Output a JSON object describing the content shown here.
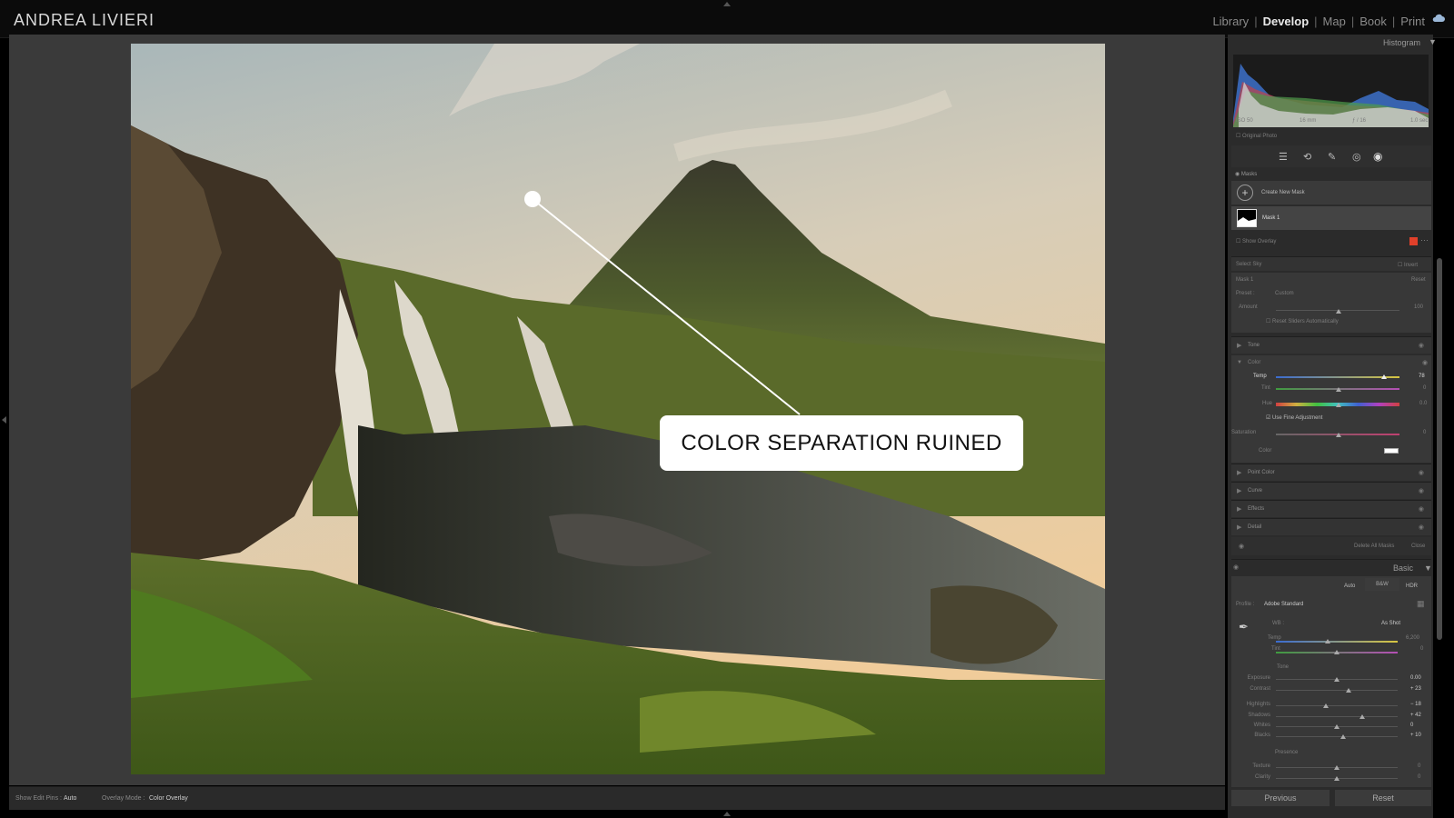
{
  "app": {
    "brand": "ANDREA LIVIERI"
  },
  "modules": [
    {
      "label": "Library",
      "active": false
    },
    {
      "label": "Develop",
      "active": true
    },
    {
      "label": "Map",
      "active": false
    },
    {
      "label": "Book",
      "active": false
    },
    {
      "label": "Print",
      "active": false
    }
  ],
  "canvas": {
    "callout": "COLOR SEPARATION RUINED"
  },
  "bottombar": {
    "show_edit_pins_label": "Show Edit Pins :",
    "show_edit_pins_value": "Auto",
    "overlay_mode_label": "Overlay Mode :",
    "overlay_mode_value": "Color Overlay"
  },
  "panel": {
    "histogram_title": "Histogram",
    "histogram_meta": [
      "ISO 50",
      "16 mm",
      "ƒ / 16",
      "1.0 sec"
    ],
    "original_photo": "Original Photo",
    "masks": {
      "title": "Masks",
      "create_new": "Create New Mask",
      "mask1": "Mask 1",
      "show_overlay": "Show Overlay"
    },
    "select_sky": {
      "label": "Select Sky",
      "invert": "Invert"
    },
    "mask_panel": {
      "mask_label": "Mask 1",
      "reset": "Reset",
      "preset_label": "Preset :",
      "preset_value": "Custom",
      "amount_label": "Amount",
      "amount_value": "100",
      "reset_sliders": "Reset Sliders Automatically"
    },
    "sections": {
      "tone": "Tone",
      "color": "Color",
      "point_color": "Point Color",
      "curve": "Curve",
      "effects": "Effects",
      "detail": "Detail"
    },
    "color": {
      "temp_label": "Temp",
      "temp_value": "78",
      "tint_label": "Tint",
      "tint_value": "0",
      "hue_label": "Hue",
      "hue_value": "0.0",
      "fine_adjust": "Use Fine Adjustment",
      "saturation_label": "Saturation",
      "saturation_value": "0",
      "color_label": "Color"
    },
    "delete_all_masks": "Delete All Masks",
    "close": "Close",
    "basic": {
      "title": "Basic",
      "auto": "Auto",
      "bw": "B&W",
      "hdr": "HDR",
      "profile_label": "Profile :",
      "profile_value": "Adobe Standard",
      "wb_label": "WB :",
      "wb_value": "As Shot",
      "temp_label": "Temp",
      "temp_value": "6,200",
      "tint_label": "Tint",
      "tint_value": "0",
      "tone_label": "Tone",
      "sliders": [
        {
          "label": "Exposure",
          "value": "0.00",
          "pos": 0.5
        },
        {
          "label": "Contrast",
          "value": "+ 23",
          "pos": 0.6
        },
        {
          "label": "Highlights",
          "value": "− 18",
          "pos": 0.41
        },
        {
          "label": "Shadows",
          "value": "+ 42",
          "pos": 0.71
        },
        {
          "label": "Whites",
          "value": "0",
          "pos": 0.5
        },
        {
          "label": "Blacks",
          "value": "+ 10",
          "pos": 0.55
        }
      ],
      "presence_label": "Presence",
      "presence": [
        {
          "label": "Texture",
          "value": "0"
        },
        {
          "label": "Clarity",
          "value": "0"
        }
      ]
    },
    "previous": "Previous",
    "reset": "Reset"
  }
}
